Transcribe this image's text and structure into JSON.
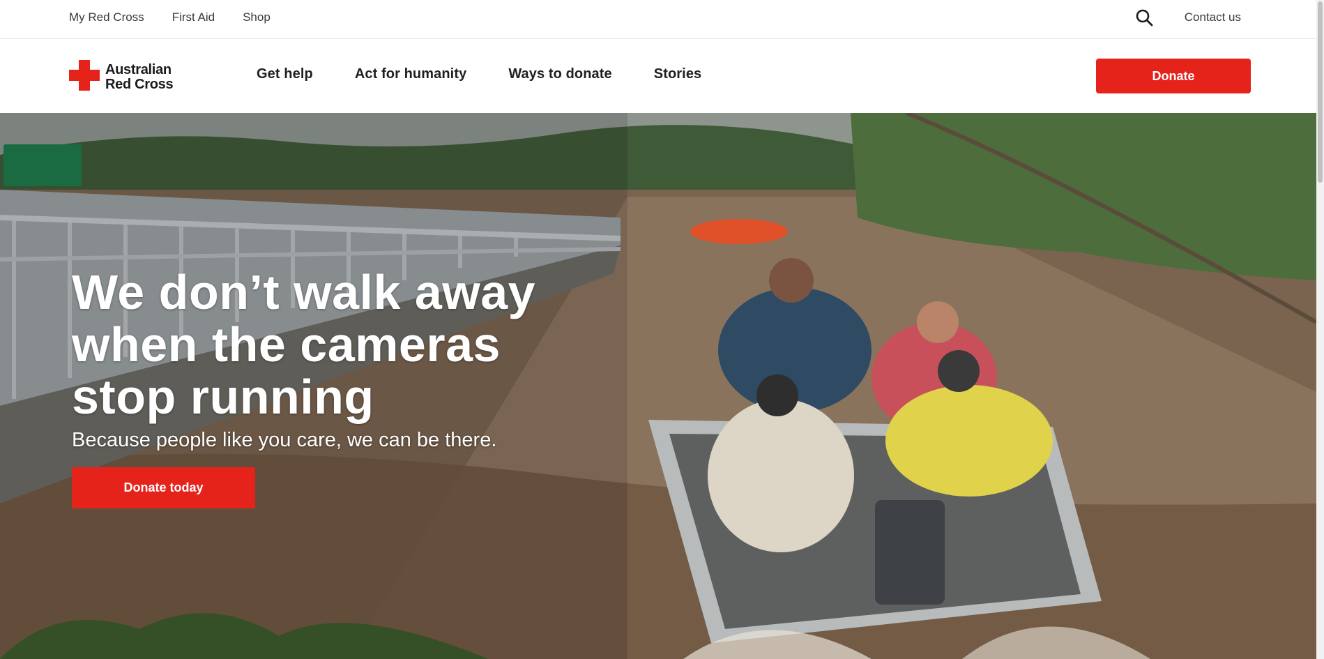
{
  "utility_nav": {
    "links": [
      "My Red Cross",
      "First Aid",
      "Shop"
    ],
    "contact_label": "Contact us",
    "search_icon": "search-icon"
  },
  "header": {
    "logo": {
      "line1": "Australian",
      "line2": "Red Cross",
      "icon": "red-cross-icon"
    },
    "nav": [
      "Get help",
      "Act for humanity",
      "Ways to donate",
      "Stories"
    ],
    "donate_label": "Donate"
  },
  "hero": {
    "title": "We don’t walk away when the cameras stop running",
    "subtitle": "Because people like you care, we can be there.",
    "cta_label": "Donate today"
  },
  "colors": {
    "brand_red": "#e5231b",
    "text_dark": "#1f1f1f"
  }
}
